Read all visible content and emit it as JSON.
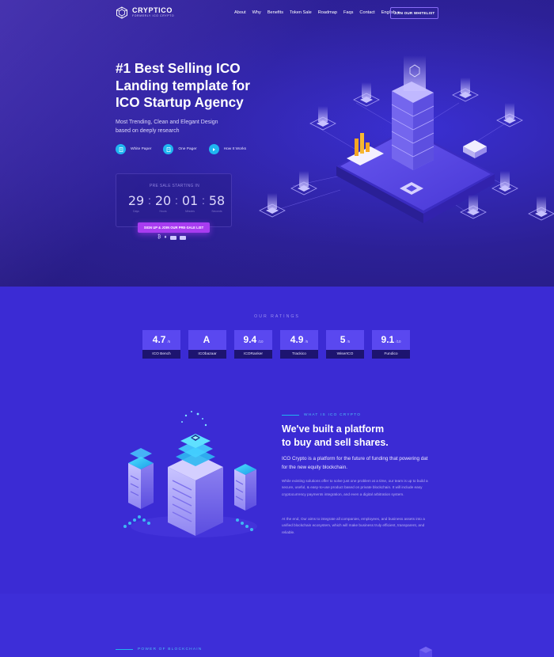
{
  "nav": {
    "brand": "CRYPTICO",
    "tagline": "FORMERLY ICO CRYPTO",
    "links": [
      "About",
      "Why",
      "Benefits",
      "Token Sale",
      "Roadmap",
      "Faqs",
      "Contact",
      "English"
    ],
    "cta": "JOIN OUR WHITELIST"
  },
  "hero": {
    "title_lines": [
      "#1 Best Selling ICO",
      "Landing template for",
      "ICO Startup Agency"
    ],
    "subtitle_lines": [
      "Most Trending, Clean and Elegant Design",
      "based on deeply research"
    ],
    "links": [
      {
        "label": "White Paper",
        "icon": "document-icon"
      },
      {
        "label": "One Pager",
        "icon": "page-icon"
      },
      {
        "label": "How It Works",
        "icon": "play-icon"
      }
    ],
    "presale": {
      "title": "PRE SALE STARTING IN",
      "countdown": [
        {
          "value": "29",
          "label": "Days"
        },
        {
          "value": "20",
          "label": "Hours"
        },
        {
          "value": "01",
          "label": "Minutes"
        },
        {
          "value": "58",
          "label": "Seconds"
        }
      ]
    },
    "signup_label": "SIGN UP & JOIN OUR PRE-SALE LIST",
    "payment_icons": [
      "bitcoin-icon",
      "ethereum-icon",
      "visa-icon",
      "mastercard-icon"
    ]
  },
  "ratings": {
    "heading": "OUR RATINGS",
    "items": [
      {
        "score": "4.7",
        "scale": "/5",
        "source": "ICO Bench"
      },
      {
        "score": "A",
        "scale": "",
        "source": "ICObazaar"
      },
      {
        "score": "9.4",
        "scale": "/10",
        "source": "ICORanker"
      },
      {
        "score": "4.9",
        "scale": "/5",
        "source": "Trackico"
      },
      {
        "score": "5",
        "scale": "/5",
        "source": "WiserICO"
      },
      {
        "score": "9.1",
        "scale": "/10",
        "source": "Fundico"
      }
    ]
  },
  "about": {
    "eyebrow": "WHAT IS ICO CRYPTO",
    "title_lines": [
      "We've built a platform",
      "to buy and sell shares."
    ],
    "lead": "ICO Crypto is a platform for the future of funding that powering dat for the new equity blockchain.",
    "p1": "While existing solutions offer to solve just one problem at a time, our team is up to build a secure, useful, & easy-to-use product based on private blockchain. It will include easy cryptocurrency payments integration, and even a digital arbitration system.",
    "p2": "At the end, Our aims to integrate all companies, employees, and business assets into a unified blockchain ecosystem, which will make business truly efficient, transparent, and reliable."
  },
  "next": {
    "eyebrow": "POWER OF BLOCKCHAIN"
  },
  "colors": {
    "accent_cyan": "#1fb5f0",
    "accent_purple": "#a83cf0",
    "hero_bg": "#2c2096",
    "section_bg": "#3b2bd4"
  }
}
